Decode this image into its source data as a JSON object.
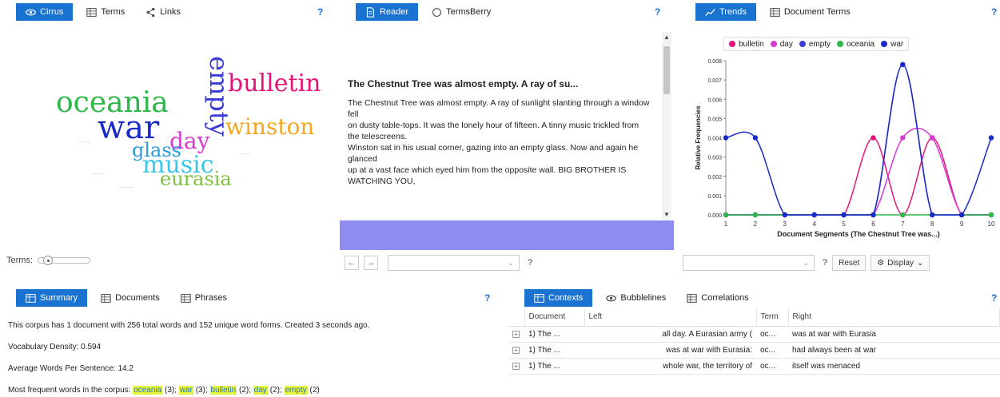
{
  "cirrus": {
    "tabs": [
      {
        "label": "Cirrus",
        "icon": "eye-icon",
        "active": true
      },
      {
        "label": "Terms",
        "icon": "table-icon",
        "active": false
      },
      {
        "label": "Links",
        "icon": "share-icon",
        "active": false
      }
    ],
    "help": "?",
    "words": [
      "oceania",
      "war",
      "empty",
      "bulletin",
      "winston",
      "day",
      "glass",
      "music",
      "eurasia"
    ],
    "terms_label": "Terms:"
  },
  "reader": {
    "tabs": [
      {
        "label": "Reader",
        "icon": "document-icon",
        "active": true
      },
      {
        "label": "TermsBerry",
        "icon": "circle-icon",
        "active": false
      }
    ],
    "help": "?",
    "title": "The Chestnut Tree was almost empty. A ray of su...",
    "paragraphs": [
      "The Chestnut Tree was almost empty. A ray of sunlight slanting through a window fell",
      "on dusty table-tops. It was the lonely hour of fifteen. A tinny music trickled from",
      "the telescreens.",
      "Winston sat in his usual corner, gazing into an empty glass. Now and again he glanced",
      "up at a vast face which eyed him from the opposite wall. BIG BROTHER IS WATCHING YOU,"
    ],
    "footer_help": "?"
  },
  "trends": {
    "tabs": [
      {
        "label": "Trends",
        "icon": "line-chart-icon",
        "active": true
      },
      {
        "label": "Document Terms",
        "icon": "table-icon",
        "active": false
      }
    ],
    "help": "?",
    "reset_label": "Reset",
    "display_label": "Display",
    "footer_help": "?"
  },
  "chart_data": {
    "type": "line",
    "xlabel": "Document Segments (The Chestnut Tree was...)",
    "ylabel": "Relative Frequencies",
    "x": [
      1,
      2,
      3,
      4,
      5,
      6,
      7,
      8,
      9,
      10
    ],
    "ylim": [
      0,
      0.008
    ],
    "yticks": [
      "0.000",
      "0.001",
      "0.002",
      "0.003",
      "0.004",
      "0.005",
      "0.006",
      "0.007",
      "0.008"
    ],
    "legend_position": "top",
    "series": [
      {
        "name": "bulletin",
        "color": "#e6127a",
        "values": [
          0,
          0,
          0,
          0,
          0,
          0.004,
          0,
          0.004,
          0,
          0
        ]
      },
      {
        "name": "day",
        "color": "#d83ad1",
        "values": [
          0,
          0,
          0,
          0,
          0,
          0,
          0.004,
          0.004,
          0,
          0
        ]
      },
      {
        "name": "empty",
        "color": "#3b3bd6",
        "values": [
          0,
          0,
          0,
          0,
          0,
          0,
          0.0078,
          0,
          0,
          0
        ]
      },
      {
        "name": "oceania",
        "color": "#2fb84a",
        "values": [
          0,
          0,
          0,
          0,
          0,
          0,
          0,
          0,
          0,
          0
        ]
      },
      {
        "name": "war",
        "color": "#1a2ac9",
        "values": [
          0.004,
          0.004,
          0,
          0,
          0,
          0,
          0.0078,
          0,
          0,
          0.004
        ]
      }
    ]
  },
  "summary": {
    "tabs": [
      {
        "label": "Summary",
        "icon": "table-icon",
        "active": true
      },
      {
        "label": "Documents",
        "icon": "table-icon",
        "active": false
      },
      {
        "label": "Phrases",
        "icon": "table-icon",
        "active": false
      }
    ],
    "help": "?",
    "line1": "This corpus has 1 document with 256 total words and 152 unique word forms. Created 3 seconds ago.",
    "line2": "Vocabulary Density: 0.594",
    "line3": "Average Words Per Sentence: 14.2",
    "frequent_label": "Most frequent words in the corpus:",
    "frequent_words": [
      {
        "word": "oceania",
        "count": "(3)"
      },
      {
        "word": "war",
        "count": "(3)"
      },
      {
        "word": "bulletin",
        "count": "(2)"
      },
      {
        "word": "day",
        "count": "(2)"
      },
      {
        "word": "empty",
        "count": "(2)"
      }
    ]
  },
  "contexts": {
    "tabs": [
      {
        "label": "Contexts",
        "icon": "table-icon",
        "active": true
      },
      {
        "label": "Bubblelines",
        "icon": "eye-icon",
        "active": false
      },
      {
        "label": "Correlations",
        "icon": "table-icon",
        "active": false
      }
    ],
    "help": "?",
    "columns": [
      "Document",
      "Left",
      "Term",
      "Right"
    ],
    "rows": [
      {
        "doc": "1) The ...",
        "left": "all day. A Eurasian army (",
        "term": "oc...",
        "right": "was at war with Eurasia"
      },
      {
        "doc": "1) The ...",
        "left": "was at war with Eurasia:",
        "term": "oc...",
        "right": "had always been at war"
      },
      {
        "doc": "1) The ...",
        "left": "whole war, the territory of",
        "term": "oc...",
        "right": "itself was menaced"
      }
    ]
  }
}
